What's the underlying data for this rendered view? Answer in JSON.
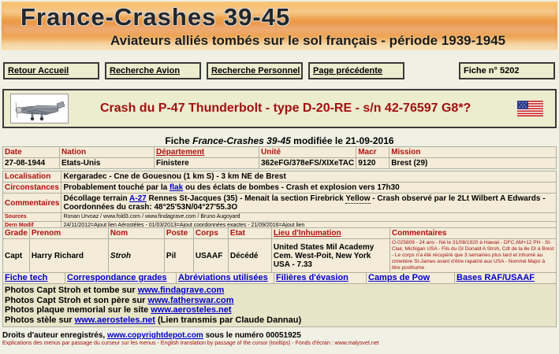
{
  "banner": {
    "title": "France-Crashes 39-45",
    "subtitle": "Aviateurs alliés tombés sur le sol français - période 1939-1945"
  },
  "nav": {
    "home": "Retour Accueil",
    "search_plane": "Recherche Avion",
    "search_person": "Recherche Personnel",
    "prev_page": "Page précédente",
    "record_no": "Fiche n° 5202"
  },
  "header": {
    "crash_title": "Crash du P-47 Thunderbolt - type D-20-RE - s/n 42-76597 G8*?",
    "modified_prefix": "Fiche ",
    "modified_italic": "France-Crashes 39-45",
    "modified_suffix": " modifiée le 21-09-2016"
  },
  "info": {
    "headers": [
      "Date",
      "Nation",
      "Département",
      "Unité",
      "Macr",
      "Mission"
    ],
    "values": [
      "27-08-1944",
      "Etats-Unis",
      "Finistere",
      "362eFG/378eFS/XIXeTAC",
      "9120",
      "Brest (29)"
    ]
  },
  "details": {
    "localisation_label": "Localisation",
    "localisation": "Kergaradec - Cne de Gouesnou (1 km S) - 3 km NE de Brest",
    "circ_label": "Circonstances",
    "circ_a": "Probablement touché par la ",
    "circ_link": "flak",
    "circ_b": " ou des éclats de bombes - Crash et explosion vers 17h30",
    "comm_label": "Commentaires",
    "comm_a": "Décollage terrain ",
    "comm_link": "A-27",
    "comm_b": " Rennes St-Jacques (35) - Menait la section Firebrick ",
    "comm_yellow": "Yellow",
    "comm_c": " - Crash observé par le 2Lt Wilbert A Edwards - Coordonnées du crash: 48°25'53N/04°27'55.3O",
    "sources_label": "Sources",
    "sources": "Ronan Urvoaz / www.fold3.com / www.findagrave.com / Bruno Augoyard",
    "dern_label": "Dern Modif",
    "dern": "24/11/2012=Ajout lien Aérostèles - 01/03/2013=Ajout coordonnées exactes - 21/09/2016=Ajout lien"
  },
  "crew": {
    "headers": [
      "Grade",
      "Prenom",
      "Nom",
      "Poste",
      "Corps",
      "Etat",
      "Lieu d'Inhumation",
      "Commentaires"
    ],
    "row": {
      "grade": "Capt",
      "prenom": "Harry Richard",
      "nom": "Stroh",
      "poste": "Pil",
      "corps": "USAAF",
      "etat": "Décédé",
      "lieu": "United States Mil Academy Cem. West-Poit, New York USA - 7.33",
      "comment": "O-025809 - 24 ans - Né le 31/08/1920 à Hawaii - DFC AM+12 PH - St-Clair, Michigan USA - Fils du GI Donald A Stroh, Cdt de la 8e DI à Brest - Le corps n'a été récupéré que 3 semaines plus tard et inhumé au cimetière St-James avant d'être rapatrié aux USA - Nommé Major à titre posthume"
    }
  },
  "links": [
    "Fiche tech",
    "Correspondance grades",
    "Abréviations utilisées",
    "Filières d'évasion",
    "Camps de Pow",
    "Bases RAF/USAAF"
  ],
  "photos": [
    {
      "text": "Photos Capt Stroh et tombe sur ",
      "link": "www.findagrave.com",
      "after": ""
    },
    {
      "text": "Photos Capt Stroh et son père sur ",
      "link": "www.fatherswar.com",
      "after": ""
    },
    {
      "text": "Photos plaque memorial sur le site ",
      "link": "www.aerosteles.net",
      "after": ""
    },
    {
      "text": "Photos stèle sur ",
      "link": "www.aerosteles.net",
      "after": " (Lien transmis par Claude Dannau)"
    }
  ],
  "footer": {
    "rights_a": "Droits d'auteur enregistrés, ",
    "rights_link": "www.copyrightdepot.com",
    "rights_b": " sous le numéro 00051925",
    "explanation": "Explications des menus par passage du curseur sur les menus - English translation by passage of the cursor (tooltips) - Fonds d'écran : www.malysvet.net"
  },
  "colors": {
    "background": "#f0f0e4",
    "header_red": "#b01010",
    "link_blue": "#0000cc"
  }
}
